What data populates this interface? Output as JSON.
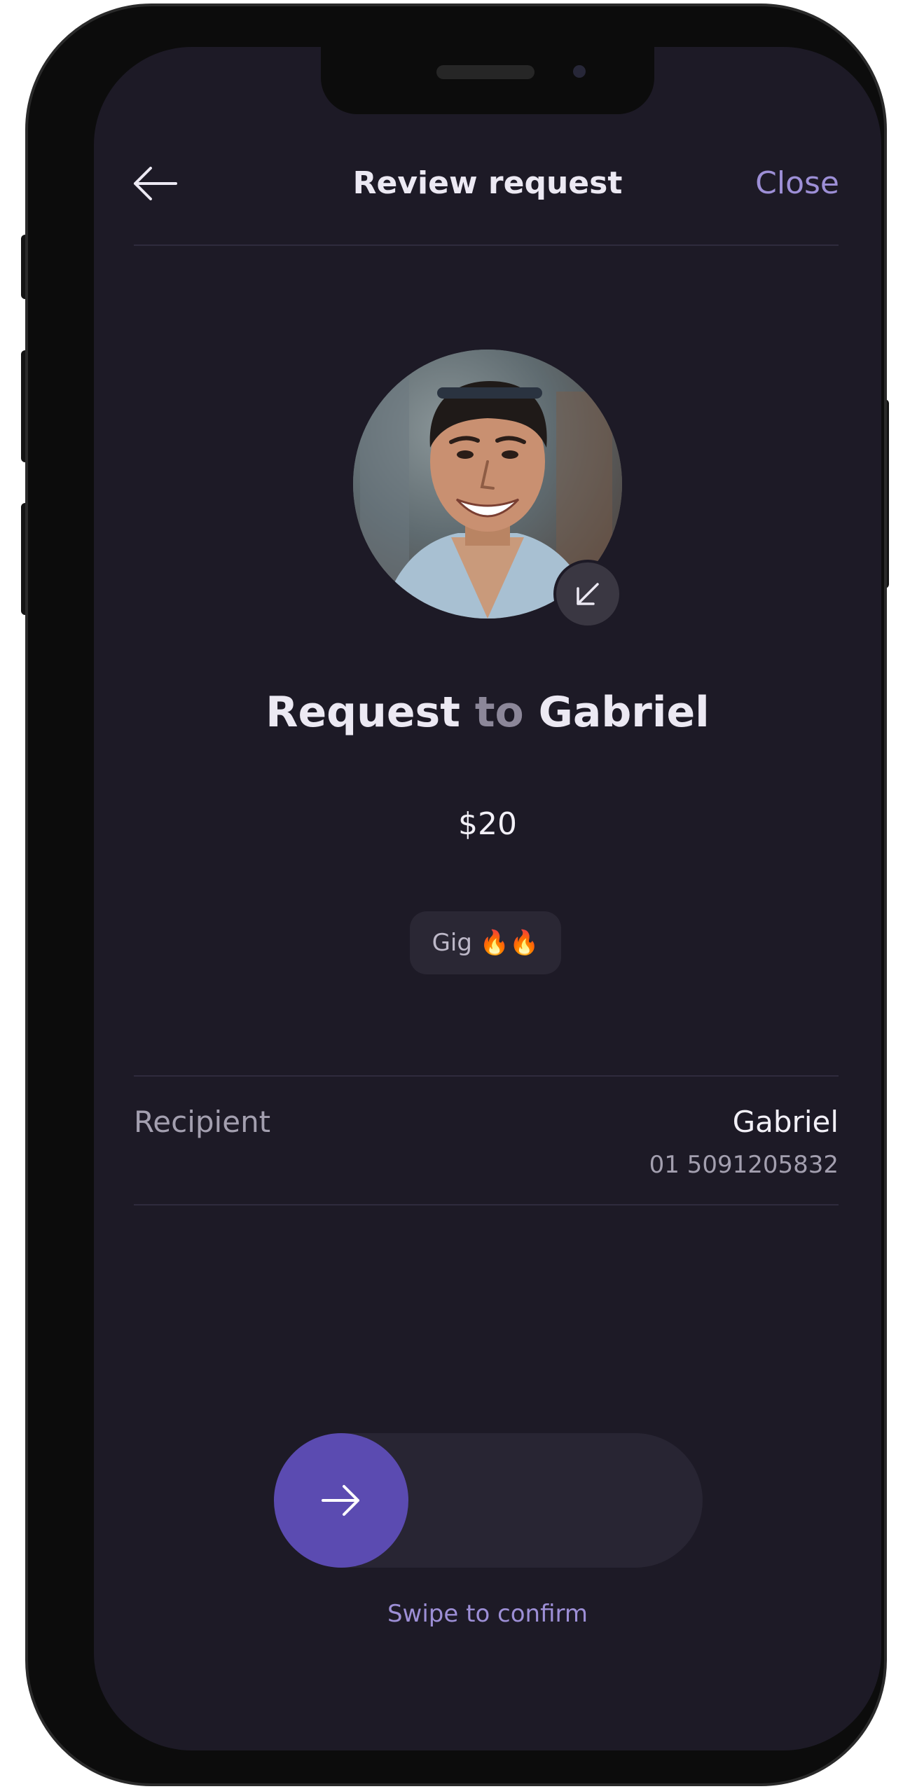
{
  "header": {
    "title": "Review request",
    "close_label": "Close",
    "back_icon": "arrow-left-icon"
  },
  "profile": {
    "photo": "person-photo",
    "badge_icon": "arrow-down-left-icon"
  },
  "request": {
    "prefix": "Request",
    "connector": "to",
    "name": "Gabriel",
    "amount": "$20",
    "note": "Gig 🔥🔥"
  },
  "recipient": {
    "label": "Recipient",
    "name": "Gabriel",
    "phone": "01 5091205832"
  },
  "confirm": {
    "label": "Swipe to confirm",
    "knob_icon": "arrow-right-icon",
    "progress": 0
  },
  "colors": {
    "background": "#1d1a26",
    "accent": "#5b4bb1",
    "accent_text": "#9d8fd6"
  }
}
